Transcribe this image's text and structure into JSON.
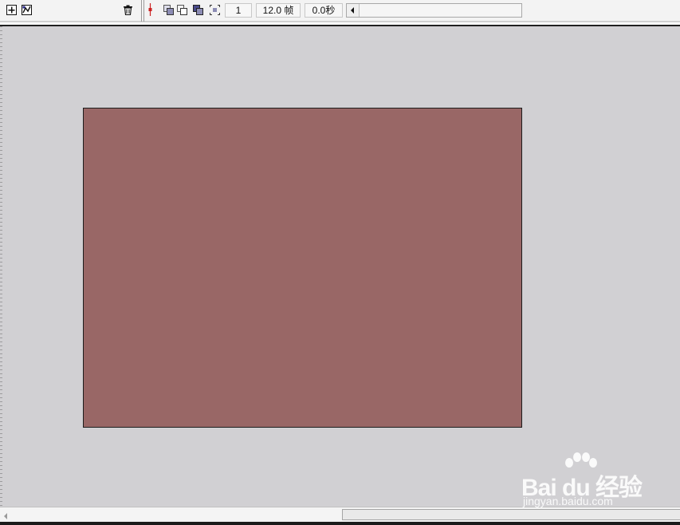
{
  "toolbar": {
    "current_frame": "1",
    "frame_rate": "12.0 帧",
    "elapsed_time": "0.0秒",
    "icons": [
      "insert-layer-icon",
      "add-motion-guide-icon",
      "delete-layer-icon",
      "playhead-marker-icon",
      "onion-skin-icon",
      "onion-skin-outlines-icon",
      "edit-multiple-frames-icon",
      "modify-onion-markers-icon",
      "scroll-left-arrow-icon"
    ]
  },
  "stage": {
    "background_color": "#d1d0d3",
    "canvas_color": "#996766",
    "canvas_border_color": "#1c1c1c"
  },
  "watermark": {
    "logo_text": "Bai du 经验",
    "url_text": "jingyan.baidu.com"
  }
}
